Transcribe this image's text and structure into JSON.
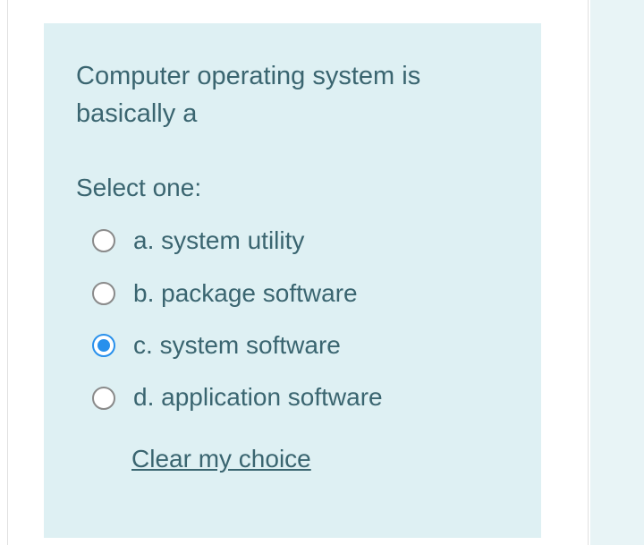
{
  "question": {
    "text": "Computer operating system is basically a",
    "instruction": "Select one:",
    "options": [
      {
        "letter": "a.",
        "text": "system utility",
        "selected": false
      },
      {
        "letter": "b.",
        "text": "package software",
        "selected": false
      },
      {
        "letter": "c.",
        "text": "system software",
        "selected": true
      },
      {
        "letter": "d.",
        "text": "application software",
        "selected": false
      }
    ],
    "clear_label": "Clear my choice"
  }
}
